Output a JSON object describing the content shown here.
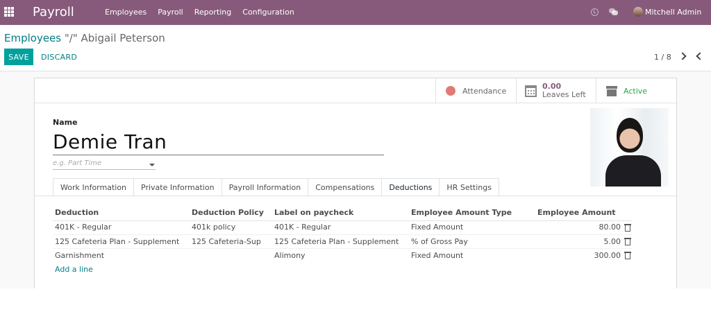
{
  "navbar": {
    "app_name": "Payroll",
    "menu": [
      "Employees",
      "Payroll",
      "Reporting",
      "Configuration"
    ],
    "user_name": "Mitchell Admin",
    "bg_color": "#875a7b"
  },
  "breadcrumb": {
    "parent": "Employees",
    "current": "\"/\" Abigail Peterson"
  },
  "actions": {
    "save_label": "SAVE",
    "discard_label": "DISCARD"
  },
  "pager": {
    "text": "1 / 8"
  },
  "button_box": {
    "attendance_label": "Attendance",
    "leaves_value": "0.00",
    "leaves_label": "Leaves Left",
    "active_label": "Active"
  },
  "employee": {
    "name_label": "Name",
    "name_value": "Demie Tran",
    "job_placeholder": "e.g. Part Time"
  },
  "tabs": [
    {
      "label": "Work Information",
      "active": false
    },
    {
      "label": "Private Information",
      "active": false
    },
    {
      "label": "Payroll Information",
      "active": false
    },
    {
      "label": "Compensations",
      "active": false
    },
    {
      "label": "Deductions",
      "active": true
    },
    {
      "label": "HR Settings",
      "active": false
    }
  ],
  "deductions": {
    "columns": [
      "Deduction",
      "Deduction Policy",
      "Label on paycheck",
      "Employee Amount Type",
      "Employee Amount"
    ],
    "rows": [
      [
        "401K - Regular",
        "401k policy",
        "401K - Regular",
        "Fixed Amount",
        "80.00"
      ],
      [
        "125 Cafeteria Plan - Supplement",
        "125 Cafeteria-Sup",
        "125 Cafeteria Plan - Supplement",
        "% of Gross Pay",
        "5.00"
      ],
      [
        "Garnishment",
        "",
        "Alimony",
        "Fixed Amount",
        "300.00"
      ]
    ],
    "add_line": "Add a line"
  }
}
